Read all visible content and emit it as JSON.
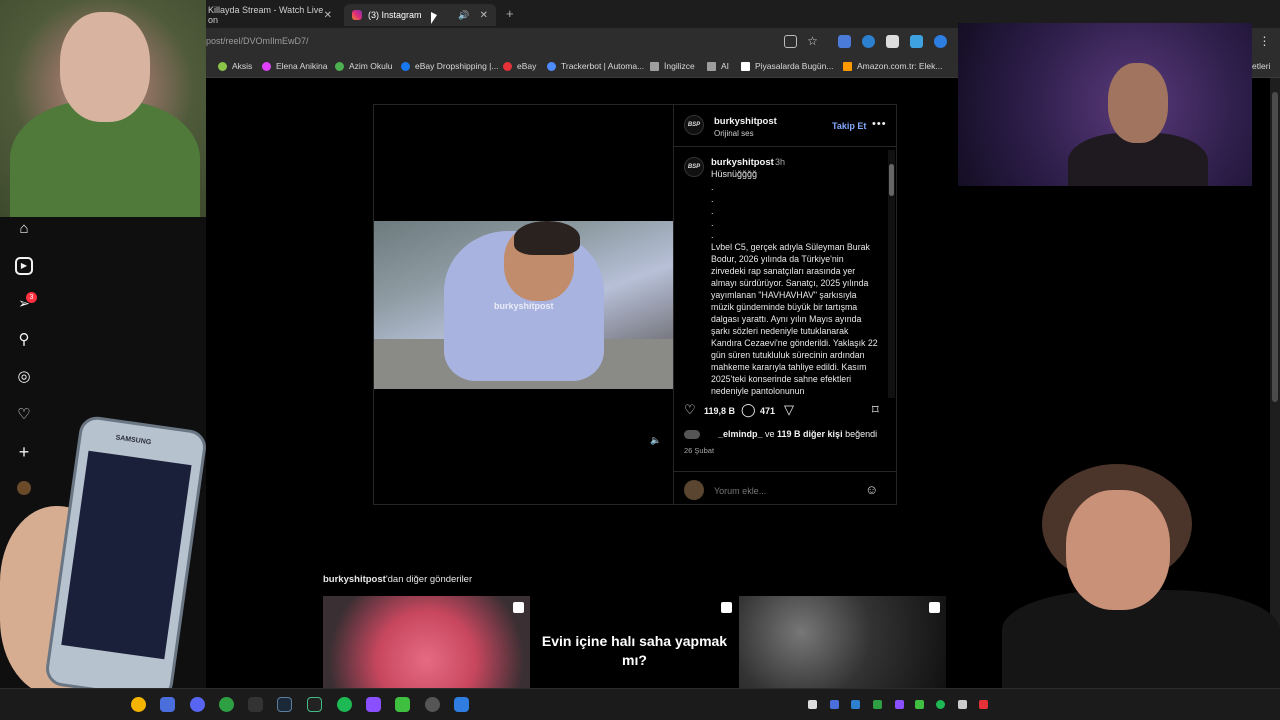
{
  "browser": {
    "tabs": [
      {
        "label": "Killayda Stream - Watch Live on",
        "close": "✕"
      },
      {
        "label": "(3) Instagram",
        "audio": "🔊",
        "close": "✕"
      }
    ],
    "new_tab": "+",
    "url": "post/reel/DVOmIlmEwD7/",
    "bookmarks": [
      {
        "label": "Aksis",
        "color": "#8bc34a"
      },
      {
        "label": "Elena Anikina",
        "color": "#e040fb"
      },
      {
        "label": "Azim Okulu",
        "color": "#4caf50"
      },
      {
        "label": "eBay Dropshipping |...",
        "color": "#1877f2"
      },
      {
        "label": "eBay",
        "color": "#e53238"
      },
      {
        "label": "Trackerbot | Automa...",
        "color": "#4f8cff"
      },
      {
        "label": "İngilizce",
        "color": "#9e9e9e"
      },
      {
        "label": "AI",
        "color": "#9e9e9e"
      },
      {
        "label": "Piyasalarda Bugün...",
        "color": "#ffffff"
      },
      {
        "label": "Amazon.com.tr: Elek...",
        "color": "#ff9900"
      }
    ],
    "bookmarks_overflow": "etleri"
  },
  "sidebar": {
    "icons": [
      "home-icon",
      "reels-icon",
      "messages-icon",
      "search-icon",
      "explore-icon",
      "heart-icon",
      "create-icon",
      "profile-icon"
    ],
    "notification_count": "3"
  },
  "post": {
    "author": "burkyshitpost",
    "avatar_text": "BSP",
    "audio": "Orijinal ses",
    "follow": "Takip Et",
    "more": "•••",
    "watermark": "burkyshitpost",
    "caption": {
      "author": "burkyshitpost",
      "time": "3h",
      "title": "Hüsnüğğğğ",
      "dots": ".\n.\n.\n.\n.",
      "body": "Lvbel C5, gerçek adıyla Süleyman Burak Bodur, 2026 yılında da Türkiye'nin zirvedeki rap sanatçıları arasında yer almayı sürdürüyor. Sanatçı, 2025 yılında yayımlanan \"HAVHAVHAV\" şarkısıyla müzik gündeminde büyük bir tartışma dalgası yarattı. Aynı yılın Mayıs ayında şarkı sözleri nedeniyle tutuklanarak Kandıra Cezaevi'ne gönderildi. Yaklaşık 22 gün süren tutukluluk sürecinin ardından mahkeme kararıyla tahliye edildi. Kasım 2025'teki konserinde sahne efektleri nedeniyle pantolonunun"
    },
    "likes": "119,8 B",
    "comments": "471",
    "liked_by_user": "_elmindp_",
    "liked_by_mid": " ve ",
    "liked_by_others": "119 B diğer kişi",
    "liked_by_suffix": " beğendi",
    "date": "26 Şubat",
    "comment_placeholder": "Yorum ekle..."
  },
  "more_posts": {
    "author": "burkyshitpost",
    "suffix": "'dan diğer gönderiler",
    "thumbs": [
      {
        "text": ""
      },
      {
        "text": "Evin içine halı saha yapmak mı?"
      },
      {
        "text": ""
      }
    ]
  },
  "phone_brand": "SAMSUNG"
}
